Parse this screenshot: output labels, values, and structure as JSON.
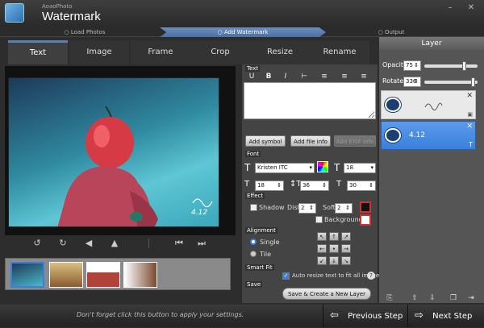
{
  "app": {
    "brand_small": "AoaoPhoto",
    "brand_big": "Watermark"
  },
  "steps": [
    {
      "label": "Load Photos",
      "active": false
    },
    {
      "label": "Add Watermark",
      "active": true
    },
    {
      "label": "Output",
      "active": false
    }
  ],
  "tabs": [
    "Text",
    "Image",
    "Frame",
    "Crop",
    "Resize",
    "Rename"
  ],
  "active_tab": "Text",
  "text_section": {
    "label": "Text",
    "format_buttons": [
      "U",
      "B",
      "I",
      "⊢",
      "≡",
      "≡",
      "≡"
    ],
    "value": "",
    "add_symbol": "Add symbol",
    "add_file_info": "Add file info",
    "add_exif_info": "Add EXIF info"
  },
  "font_section": {
    "label": "Font",
    "font_family": "Kristen ITC",
    "font_size": "18",
    "spacing1": "18",
    "spacing2": "36",
    "spacing3": "30"
  },
  "effect_section": {
    "label": "Effect",
    "shadow_label": "Shadow",
    "dist_label": "Dist",
    "dist_value": "2",
    "soft_label": "Soft",
    "soft_value": "2",
    "background_label": "Background"
  },
  "alignment_section": {
    "label": "Alignment",
    "single_label": "Single",
    "tile_label": "Tile",
    "arrows": [
      "↖",
      "↑",
      "↗",
      "←",
      "•",
      "→",
      "↙",
      "↓",
      "↘"
    ]
  },
  "smartfit_section": {
    "label": "Smart Fit",
    "checkbox_label": "Auto resize text to fit all images."
  },
  "save_section": {
    "label": "Save",
    "button": "Save & Create a New Layer"
  },
  "layer_panel": {
    "title": "Layer",
    "opacity_label": "Opacity",
    "opacity_value": "75",
    "opacity_level": 0.75,
    "rotate_label": "Rotate",
    "rotate_value": "336",
    "rotate_level": 0.93,
    "layers": [
      {
        "label": "",
        "type": "image"
      },
      {
        "label": "4.12",
        "type": "text"
      }
    ]
  },
  "watermark_text": "4.12",
  "footer": {
    "hint": "Don't forget click this button to apply your settings.",
    "previous": "Previous Step",
    "next": "Next Step"
  },
  "colors": {
    "accent": "#5a7fb5",
    "selected_layer": "#3a7fdc"
  }
}
